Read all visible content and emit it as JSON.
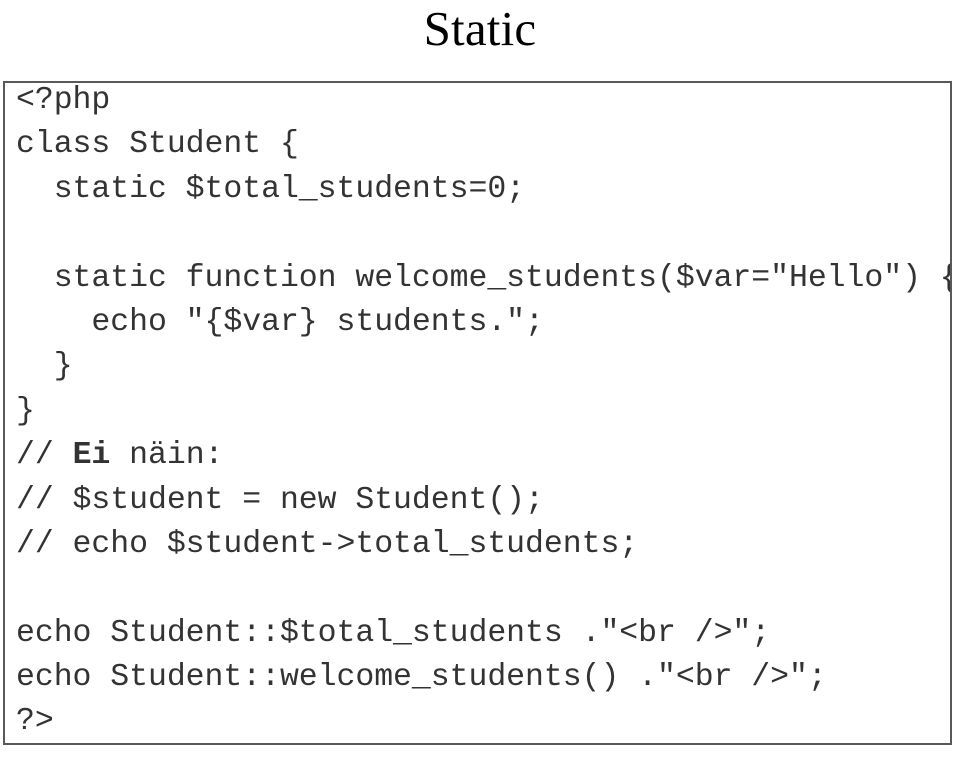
{
  "slide": {
    "title": "Static",
    "title_color": "#000000",
    "background_color": "#ffffff"
  },
  "code_box": {
    "border_color": "#595959",
    "text_color": "#333333",
    "language": "php",
    "lines": [
      {
        "id": "line-1",
        "text": "<?php"
      },
      {
        "id": "line-2",
        "text": "class Student {"
      },
      {
        "id": "line-3",
        "text": "  static $total_students=0;"
      },
      {
        "id": "line-4",
        "text": ""
      },
      {
        "id": "line-5",
        "text": "  static function welcome_students($var=\"Hello\") {"
      },
      {
        "id": "line-6",
        "text": "    echo \"{$var} students.\";"
      },
      {
        "id": "line-7",
        "text": "  }"
      },
      {
        "id": "line-8",
        "text": "}"
      },
      {
        "id": "line-9",
        "text": "// Ei näin:",
        "prefix": "// ",
        "bold": "Ei",
        "suffix": " näin:"
      },
      {
        "id": "line-10",
        "text": "// $student = new Student();"
      },
      {
        "id": "line-11",
        "text": "// echo $student->total_students;"
      },
      {
        "id": "line-12",
        "text": ""
      },
      {
        "id": "line-13",
        "text": "echo Student::$total_students .\"<br />\";"
      },
      {
        "id": "line-14",
        "text": "echo Student::welcome_students() .\"<br />\";"
      },
      {
        "id": "line-15",
        "text": "?>"
      }
    ]
  }
}
